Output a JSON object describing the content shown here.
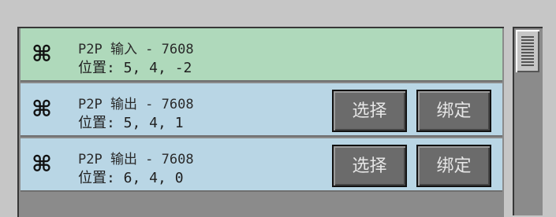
{
  "entries": [
    {
      "type": "input",
      "title": "P2P 输入 - 7608",
      "position": "位置: 5, 4, -2",
      "icon": "network-icon"
    },
    {
      "type": "output",
      "title": "P2P 输出 - 7608",
      "position": "位置: 5, 4, 1",
      "icon": "network-icon",
      "select_label": "选择",
      "bind_label": "绑定"
    },
    {
      "type": "output",
      "title": "P2P 输出 - 7608",
      "position": "位置: 6, 4, 0",
      "icon": "network-icon",
      "select_label": "选择",
      "bind_label": "绑定"
    }
  ],
  "icon_glyph": "⌘",
  "colors": {
    "input_row": "#afd9bb",
    "output_row": "#b9d6e5",
    "button": "#6b6b6b",
    "background": "#c6c6c6"
  }
}
